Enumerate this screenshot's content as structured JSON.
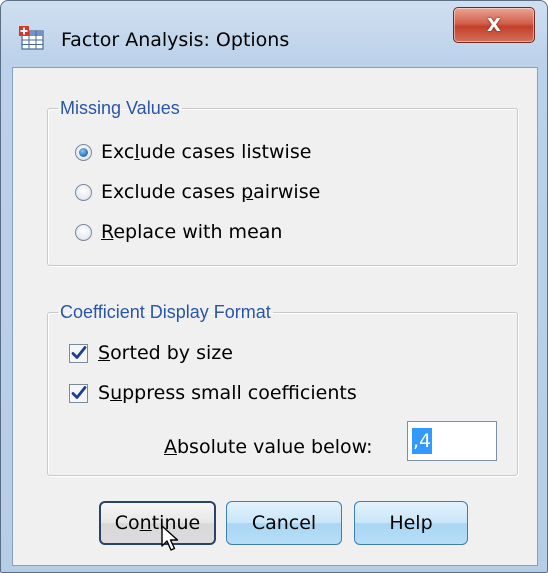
{
  "window": {
    "title": "Factor Analysis: Options",
    "app_icon": "spss-table-icon",
    "close_icon": "close-icon",
    "close_label": "X",
    "accent_color": "#2a55a8",
    "close_color": "#c1402b"
  },
  "missing_values": {
    "legend": "Missing Values",
    "options": [
      {
        "pre": "Exc",
        "u": "l",
        "post": "ude cases listwise",
        "checked": true
      },
      {
        "pre": "Exclude cases ",
        "u": "p",
        "post": "airwise",
        "checked": false
      },
      {
        "pre": "",
        "u": "R",
        "post": "eplace with mean",
        "checked": false
      }
    ]
  },
  "coefficient_format": {
    "legend": "Coefficient Display Format",
    "sorted": {
      "pre": "",
      "u": "S",
      "post": "orted by size",
      "checked": true
    },
    "suppress": {
      "pre": "S",
      "u": "u",
      "post": "ppress small coefficients",
      "checked": true
    },
    "absolute": {
      "pre": "",
      "u": "A",
      "post": "bsolute value below:",
      "value": ",4"
    }
  },
  "buttons": {
    "continue": {
      "pre": "Co",
      "u": "n",
      "post": "tinue"
    },
    "cancel": "Cancel",
    "help": "Help"
  },
  "icons": {
    "checkmark": "checkmark-icon",
    "cursor": "mouse-pointer-icon"
  }
}
